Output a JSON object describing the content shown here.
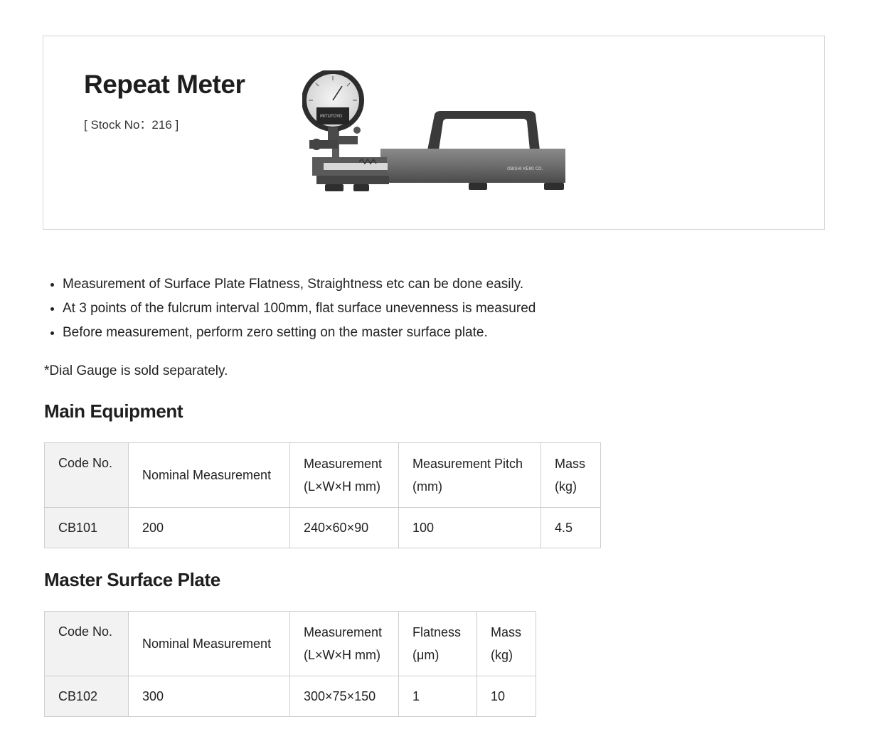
{
  "product": {
    "title": "Repeat Meter",
    "stock_label": "[ Stock No：216 ]"
  },
  "image": {
    "dial_brand": "MITUTOYO",
    "body_marking": "OBISHI KEIKI CO."
  },
  "features": [
    "Measurement of Surface Plate Flatness, Straightness etc can be done easily.",
    "At 3 points of the fulcrum interval 100mm, flat surface unevenness is measured",
    "Before measurement, perform zero setting on the master surface plate."
  ],
  "note": "*Dial Gauge is sold separately.",
  "main_equipment": {
    "heading": "Main Equipment",
    "headers": {
      "code": "Code No.",
      "nominal": "Nominal Measurement",
      "measurement_1": "Measurement",
      "measurement_2": "(L×W×H mm)",
      "pitch_1": "Measurement Pitch",
      "pitch_2": "(mm)",
      "mass_1": "Mass",
      "mass_2": "(kg)"
    },
    "rows": [
      {
        "code": "CB101",
        "nominal": "200",
        "measurement": "240×60×90",
        "pitch": "100",
        "mass": "4.5"
      }
    ]
  },
  "master_plate": {
    "heading": "Master Surface Plate",
    "headers": {
      "code": "Code No.",
      "nominal": "Nominal Measurement",
      "measurement_1": "Measurement",
      "measurement_2": "(L×W×H mm)",
      "flatness_1": "Flatness",
      "flatness_2": "(μm)",
      "mass_1": "Mass",
      "mass_2": "(kg)"
    },
    "rows": [
      {
        "code": "CB102",
        "nominal": "300",
        "measurement": "300×75×150",
        "flatness": "1",
        "mass": "10"
      }
    ]
  }
}
